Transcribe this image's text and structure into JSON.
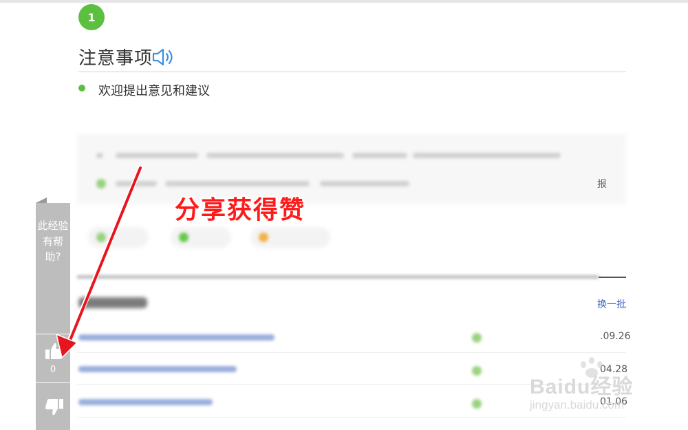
{
  "step": {
    "number": "1"
  },
  "notice": {
    "title": "注意事项",
    "icon": "speaker-icon",
    "bullet": "欢迎提出意见和建议"
  },
  "right_column": {
    "report": "报",
    "change_batch": "换一批",
    "dates": [
      ".09.26",
      "04.28",
      "01.06"
    ]
  },
  "overlay": {
    "caption": "分享获得赞"
  },
  "vote": {
    "question": "此经验有帮助?",
    "like_count": "0",
    "up_icon": "thumbs-up-icon",
    "down_icon": "thumbs-down-icon"
  },
  "watermark": {
    "brand": "Baidu经验",
    "url": "jingyan.baidu.com"
  },
  "colors": {
    "accent_green": "#5cbf3f",
    "arrow_red": "#e8141e",
    "caption_red": "#ff1a1a",
    "link_blue": "#3f66c4",
    "sidebar_gray": "#bdbdbd"
  }
}
